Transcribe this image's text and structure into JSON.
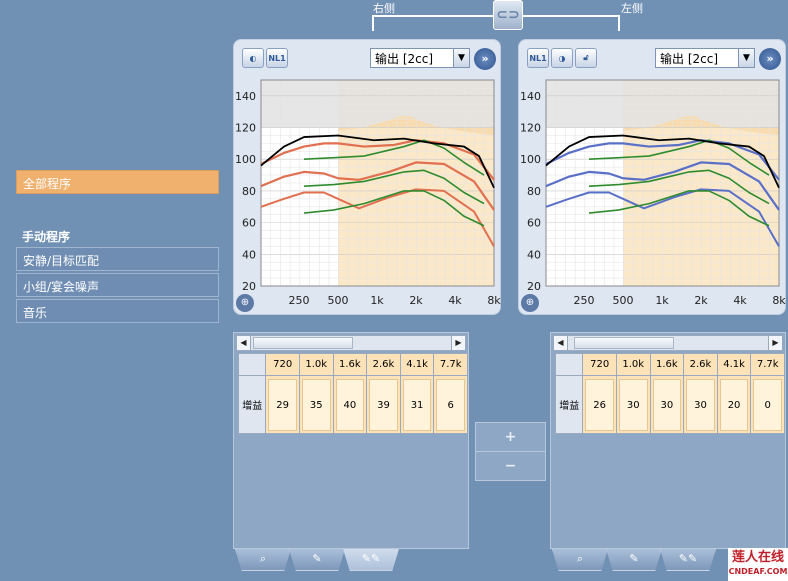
{
  "header": {
    "right_label": "右侧",
    "left_label": "左侧",
    "link_icon": "link-icon"
  },
  "programs": {
    "all_programs": "全部程序",
    "manual_heading": "手动程序",
    "items": [
      "安静/目标匹配",
      "小组/宴会噪声",
      "音乐"
    ]
  },
  "right_panel": {
    "select_value": "输出 [2cc]",
    "nl1_label": "NL1",
    "color": "#e07050",
    "gain_headers": [
      "720",
      "1.0k",
      "1.6k",
      "2.6k",
      "4.1k",
      "7.7k"
    ],
    "gain_row_label": "增益",
    "gain_values": [
      "29",
      "35",
      "40",
      "39",
      "31",
      "6"
    ]
  },
  "left_panel": {
    "select_value": "输出 [2cc]",
    "nl1_label": "NL1",
    "color": "#5a70c8",
    "gain_headers": [
      "720",
      "1.0k",
      "1.6k",
      "2.6k",
      "4.1k",
      "7.7k"
    ],
    "gain_row_label": "增益",
    "gain_values": [
      "26",
      "30",
      "30",
      "30",
      "20",
      "0"
    ]
  },
  "chart_axes": {
    "y_ticks": [
      "140",
      "120",
      "100",
      "80",
      "60",
      "40",
      "20"
    ],
    "x_ticks": [
      "250",
      "500",
      "1k",
      "2k",
      "4k",
      "8k"
    ]
  },
  "controls": {
    "plus": "+",
    "minus": "−"
  },
  "logo": {
    "main": "莲人在线",
    "sub": "CNDEAF.COM"
  }
}
